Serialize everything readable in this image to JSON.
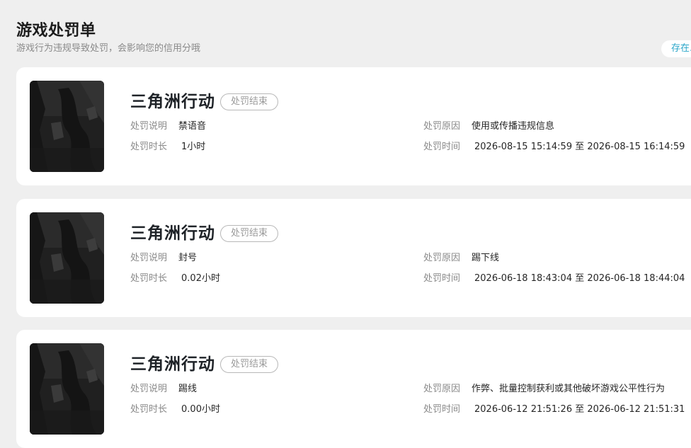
{
  "header": {
    "title": "游戏处罚单",
    "subtitle": "游戏行为违规导致处罚，会影响您的信用分哦",
    "tag": "存在..."
  },
  "labels": {
    "description": "处罚说明",
    "reason": "处罚原因",
    "duration": "处罚时长",
    "time": "处罚时间"
  },
  "penalties": [
    {
      "game": "三角洲行动",
      "status": "处罚结束",
      "description": "禁语音",
      "reason": "使用或传播违规信息",
      "duration": "1小时",
      "time": "2026-08-15 15:14:59 至 2026-08-15 16:14:59"
    },
    {
      "game": "三角洲行动",
      "status": "处罚结束",
      "description": "封号",
      "reason": "踢下线",
      "duration": "0.02小时",
      "time": "2026-06-18 18:43:04 至 2026-06-18 18:44:04"
    },
    {
      "game": "三角洲行动",
      "status": "处罚结束",
      "description": "踢线",
      "reason": "作弊、批量控制获利或其他破坏游戏公平性行为",
      "duration": "0.00小时",
      "time": "2026-06-12 21:51:26 至 2026-06-12 21:51:31"
    }
  ]
}
